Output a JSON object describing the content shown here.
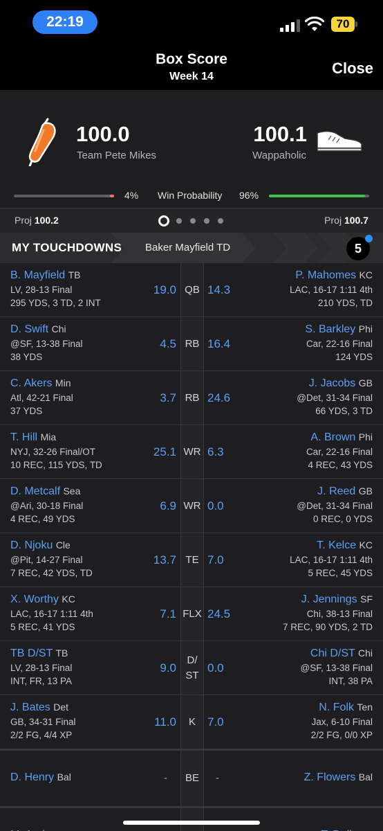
{
  "status": {
    "time": "22:19",
    "battery": "70"
  },
  "header": {
    "title": "Box Score",
    "subtitle": "Week 14",
    "close": "Close"
  },
  "teams": {
    "left": {
      "score": "100.0",
      "name": "Team Pete Mikes",
      "win_pct": "4%",
      "proj_label": "Proj",
      "proj": "100.2"
    },
    "right": {
      "score": "100.1",
      "name": "Wappaholic",
      "win_pct": "96%",
      "proj_label": "Proj",
      "proj": "100.7"
    },
    "win_label": "Win Probability",
    "win_fraction_left": 0.04,
    "win_fraction_right": 0.96
  },
  "pager": {
    "count": 5,
    "active": 0
  },
  "touchdowns": {
    "title": "MY TOUCHDOWNS",
    "text": "Baker Mayfield TD",
    "count": "5"
  },
  "colors": {
    "accent": "#5b9ff5",
    "time_pill": "#2f7ff5",
    "win_green": "#3ec24a",
    "loss_red": "#ff6b6b"
  },
  "rows": [
    {
      "pos": "QB",
      "left": {
        "name": "B. Mayfield",
        "team": "TB",
        "l1": "LV, 28-13 Final",
        "l2": "295 YDS, 3 TD, 2 INT",
        "pts": "19.0"
      },
      "right": {
        "name": "P. Mahomes",
        "team": "KC",
        "l1": "LAC, 16-17 1:11 4th",
        "l2": "210 YDS, TD",
        "pts": "14.3"
      }
    },
    {
      "pos": "RB",
      "left": {
        "name": "D. Swift",
        "team": "Chi",
        "l1": "@SF, 13-38 Final",
        "l2": "38 YDS",
        "pts": "4.5"
      },
      "right": {
        "name": "S. Barkley",
        "team": "Phi",
        "l1": "Car, 22-16 Final",
        "l2": "124 YDS",
        "pts": "16.4"
      }
    },
    {
      "pos": "RB",
      "left": {
        "name": "C. Akers",
        "team": "Min",
        "l1": "Atl, 42-21 Final",
        "l2": "37 YDS",
        "pts": "3.7"
      },
      "right": {
        "name": "J. Jacobs",
        "team": "GB",
        "l1": "@Det, 31-34 Final",
        "l2": "66 YDS, 3 TD",
        "pts": "24.6"
      }
    },
    {
      "pos": "WR",
      "left": {
        "name": "T. Hill",
        "team": "Mia",
        "l1": "NYJ, 32-26 Final/OT",
        "l2": "10 REC, 115 YDS, TD",
        "pts": "25.1"
      },
      "right": {
        "name": "A. Brown",
        "team": "Phi",
        "l1": "Car, 22-16 Final",
        "l2": "4 REC, 43 YDS",
        "pts": "6.3"
      }
    },
    {
      "pos": "WR",
      "left": {
        "name": "D. Metcalf",
        "team": "Sea",
        "l1": "@Ari, 30-18 Final",
        "l2": "4 REC, 49 YDS",
        "pts": "6.9"
      },
      "right": {
        "name": "J. Reed",
        "team": "GB",
        "l1": "@Det, 31-34 Final",
        "l2": "0 REC, 0 YDS",
        "pts": "0.0"
      }
    },
    {
      "pos": "TE",
      "left": {
        "name": "D. Njoku",
        "team": "Cle",
        "l1": "@Pit, 14-27 Final",
        "l2": "7 REC, 42 YDS, TD",
        "pts": "13.7"
      },
      "right": {
        "name": "T. Kelce",
        "team": "KC",
        "l1": "LAC, 16-17 1:11 4th",
        "l2": "5 REC, 45 YDS",
        "pts": "7.0"
      }
    },
    {
      "pos": "FLX",
      "left": {
        "name": "X. Worthy",
        "team": "KC",
        "l1": "LAC, 16-17 1:11 4th",
        "l2": "5 REC, 41 YDS",
        "pts": "7.1"
      },
      "right": {
        "name": "J. Jennings",
        "team": "SF",
        "l1": "Chi, 38-13 Final",
        "l2": "7 REC, 90 YDS, 2 TD",
        "pts": "24.5"
      }
    },
    {
      "pos": "D/\nST",
      "left": {
        "name": "TB D/ST",
        "team": "TB",
        "l1": "LV, 28-13 Final",
        "l2": "INT, FR, 13 PA",
        "pts": "9.0"
      },
      "right": {
        "name": "Chi D/ST",
        "team": "Chi",
        "l1": "@SF, 13-38 Final",
        "l2": "INT, 38 PA",
        "pts": "0.0"
      }
    },
    {
      "pos": "K",
      "left": {
        "name": "J. Bates",
        "team": "Det",
        "l1": "GB, 34-31 Final",
        "l2": "2/2 FG, 4/4 XP",
        "pts": "11.0"
      },
      "right": {
        "name": "N. Folk",
        "team": "Ten",
        "l1": "Jax, 6-10 Final",
        "l2": "2/2 FG, 0/0 XP",
        "pts": "7.0"
      }
    }
  ],
  "bench": [
    {
      "pos": "BE",
      "left": {
        "name": "D. Henry",
        "team": "Bal",
        "pts": "-"
      },
      "right": {
        "name": "Z. Flowers",
        "team": "Bal",
        "pts": "-"
      }
    },
    {
      "pos": "BE",
      "left": {
        "name": "M. Andrews",
        "team": "Bal",
        "pts": ""
      },
      "right": {
        "name": "T. Dell",
        "team": "Hou",
        "pts": ""
      }
    }
  ]
}
